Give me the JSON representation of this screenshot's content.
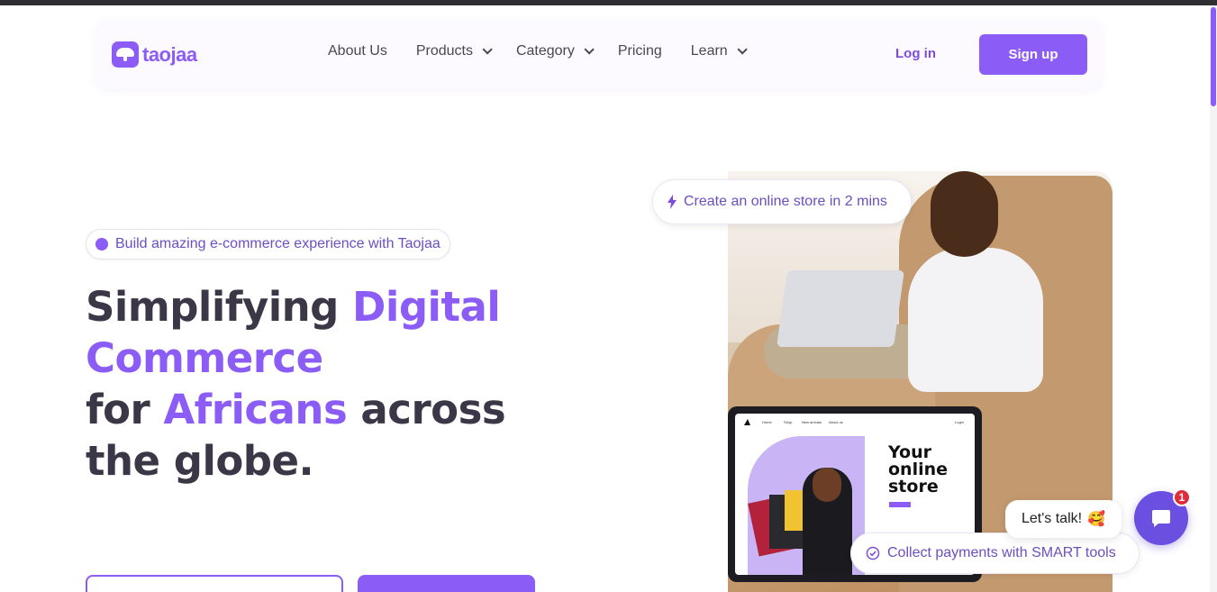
{
  "brand": {
    "name": "taojaa",
    "accent": "#8b5cf6"
  },
  "nav": {
    "items": [
      {
        "label": "About Us",
        "dropdown": false
      },
      {
        "label": "Products",
        "dropdown": true
      },
      {
        "label": "Category",
        "dropdown": true
      },
      {
        "label": "Pricing",
        "dropdown": false
      },
      {
        "label": "Learn",
        "dropdown": true
      }
    ],
    "login_label": "Log in",
    "signup_label": "Sign up"
  },
  "hero": {
    "tagline": "Build amazing e-commerce experience with Taojaa",
    "headline": {
      "part1": "Simplifying ",
      "part2_highlight": "Digital Commerce",
      "part3": "for ",
      "part4_highlight": "Africans",
      "part5": " across the globe."
    }
  },
  "badges": {
    "create_store": "Create an online store in 2 mins",
    "collect_payments": "Collect payments with SMART tools"
  },
  "mockup": {
    "title": "Your online store",
    "nav_links": [
      "Home",
      "Shop",
      "New arrivals",
      "About us"
    ],
    "login": "Login"
  },
  "chat": {
    "prompt": "Let's talk!",
    "emoji": "🥰",
    "unread_count": "1"
  }
}
